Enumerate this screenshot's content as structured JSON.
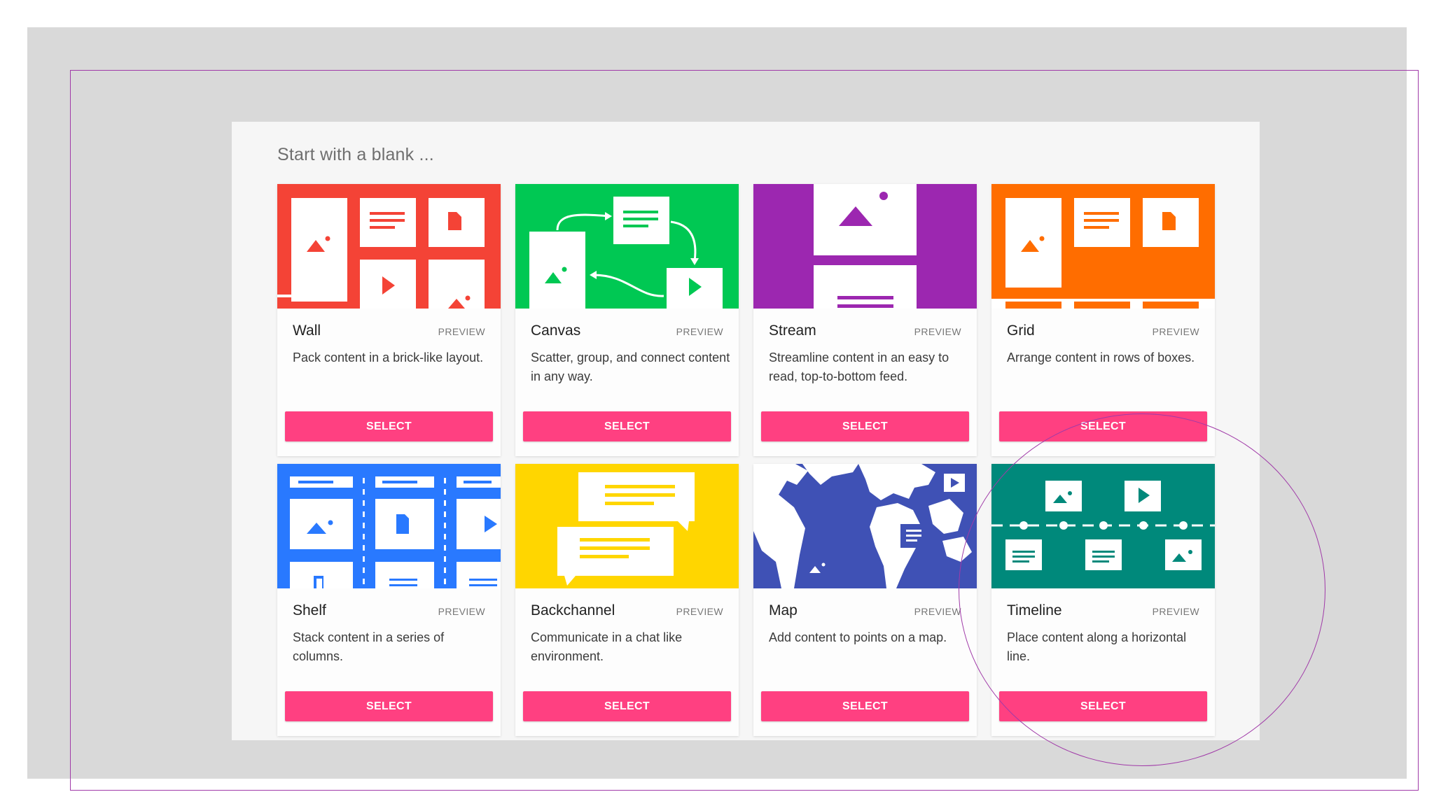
{
  "heading": "Start with a blank ...",
  "cards": [
    {
      "title": "Wall",
      "preview": "PREVIEW",
      "description": "Pack content in a brick-like layout.",
      "button": "SELECT",
      "color": "#f44336",
      "icon": "wall-layout-illustration"
    },
    {
      "title": "Canvas",
      "preview": "PREVIEW",
      "description": "Scatter, group, and connect content in any way.",
      "button": "SELECT",
      "color": "#00c853",
      "icon": "canvas-layout-illustration"
    },
    {
      "title": "Stream",
      "preview": "PREVIEW",
      "description": "Streamline content in an easy to read, top-to-bottom feed.",
      "button": "SELECT",
      "color": "#9c27b0",
      "icon": "stream-layout-illustration"
    },
    {
      "title": "Grid",
      "preview": "PREVIEW",
      "description": "Arrange content in rows of boxes.",
      "button": "SELECT",
      "color": "#ff6d00",
      "icon": "grid-layout-illustration"
    },
    {
      "title": "Shelf",
      "preview": "PREVIEW",
      "description": "Stack content in a series of columns.",
      "button": "SELECT",
      "color": "#2979ff",
      "icon": "shelf-layout-illustration"
    },
    {
      "title": "Backchannel",
      "preview": "PREVIEW",
      "description": "Communicate in a chat like environment.",
      "button": "SELECT",
      "color": "#ffd600",
      "icon": "backchannel-layout-illustration"
    },
    {
      "title": "Map",
      "preview": "PREVIEW",
      "description": "Add content to points on a map.",
      "button": "SELECT",
      "color": "#3f51b5",
      "icon": "map-layout-illustration"
    },
    {
      "title": "Timeline",
      "preview": "PREVIEW",
      "description": "Place content along a horizontal line.",
      "button": "SELECT",
      "color": "#00897b",
      "icon": "timeline-layout-illustration"
    }
  ],
  "colors": {
    "select_button": "#ff4081",
    "annotation": "#a03aa8",
    "background": "#d9d9d9",
    "panel": "#f6f6f6"
  }
}
